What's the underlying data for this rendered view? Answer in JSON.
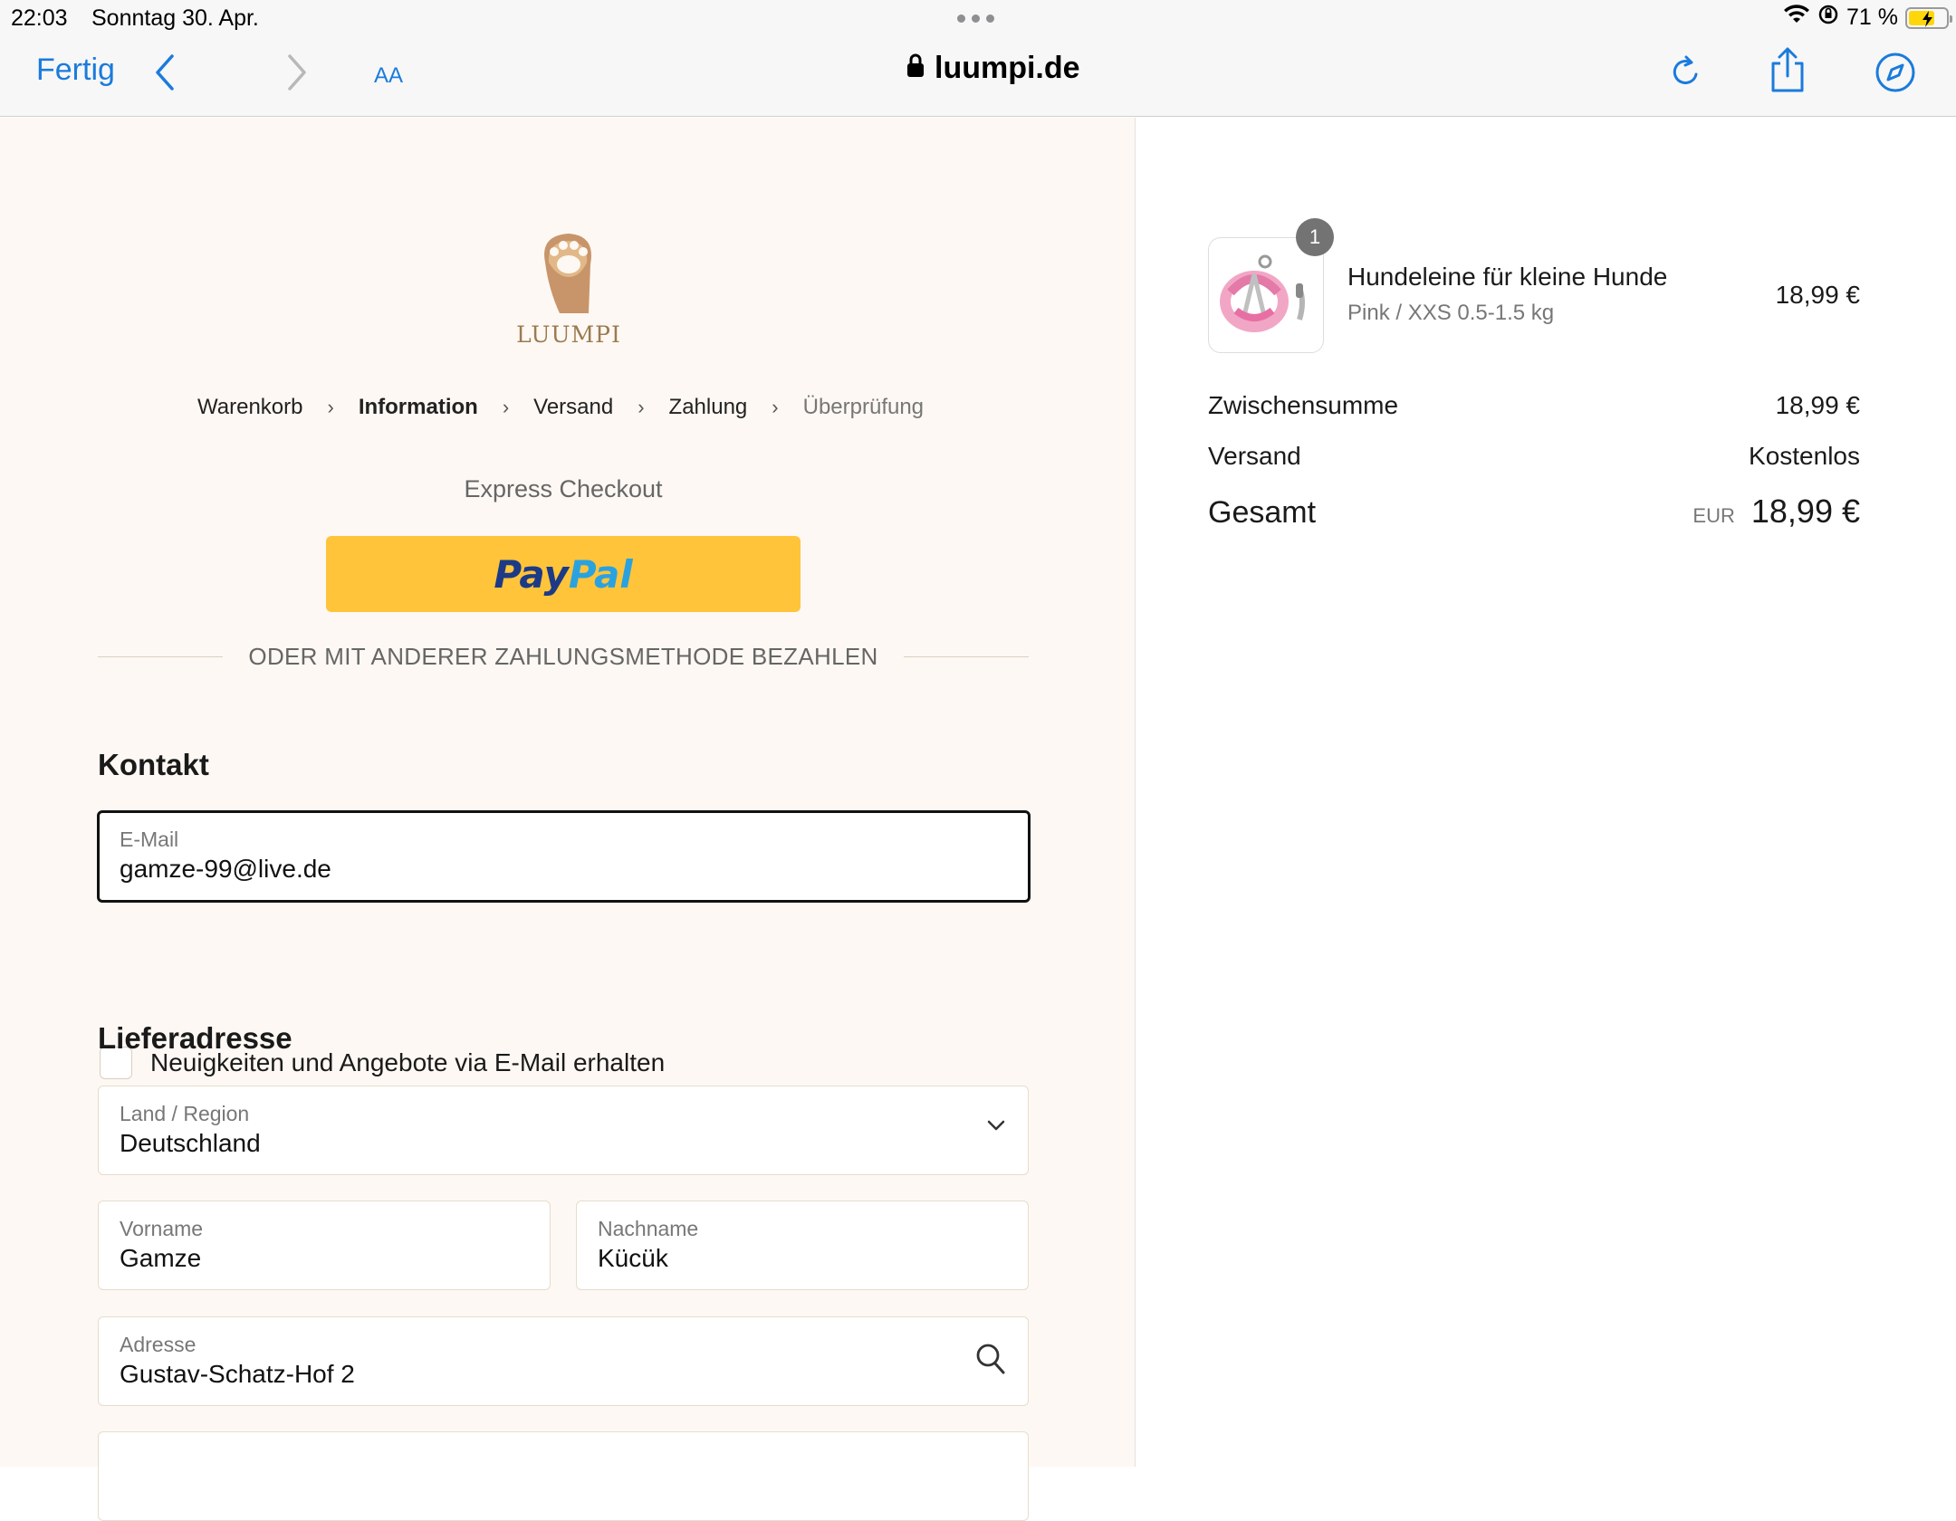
{
  "status_bar": {
    "time": "22:03",
    "date": "Sonntag 30. Apr.",
    "battery": "71 %",
    "battery_level": 0.71
  },
  "toolbar": {
    "done_label": "Fertig",
    "text_size_label": "AA",
    "url": "luumpi.de"
  },
  "shop": {
    "logo_text": "LUUMPI"
  },
  "breadcrumb": [
    "Warenkorb",
    "Information",
    "Versand",
    "Zahlung",
    "Überprüfung"
  ],
  "express": {
    "title": "Express Checkout",
    "paypal_part1": "Pay",
    "paypal_part2": "Pal",
    "divider_text": "ODER MIT ANDERER ZAHLUNGSMETHODE BEZAHLEN"
  },
  "contact": {
    "title": "Kontakt",
    "email_label": "E-Mail",
    "email_value": "gamze-99@live.de",
    "newsletter_label": "Neuigkeiten und Angebote via E-Mail erhalten"
  },
  "shipping": {
    "title": "Lieferadresse",
    "country_label": "Land / Region",
    "country_value": "Deutschland",
    "firstname_label": "Vorname",
    "firstname_value": "Gamze",
    "lastname_label": "Nachname",
    "lastname_value": "Kücük",
    "address_label": "Adresse",
    "address_value": "Gustav-Schatz-Hof 2"
  },
  "summary": {
    "quantity": "1",
    "product_name": "Hundeleine für kleine Hunde",
    "product_variant": "Pink / XXS 0.5-1.5 kg",
    "product_price": "18,99 €",
    "subtotal_label": "Zwischensumme",
    "subtotal_value": "18,99 €",
    "shipping_label": "Versand",
    "shipping_value": "Kostenlos",
    "total_label": "Gesamt",
    "total_currency": "EUR",
    "total_value": "18,99 €"
  },
  "colors": {
    "accent": "#1a7bdc",
    "paypal_yellow": "#ffc43a",
    "left_bg": "#fdf8f3"
  }
}
